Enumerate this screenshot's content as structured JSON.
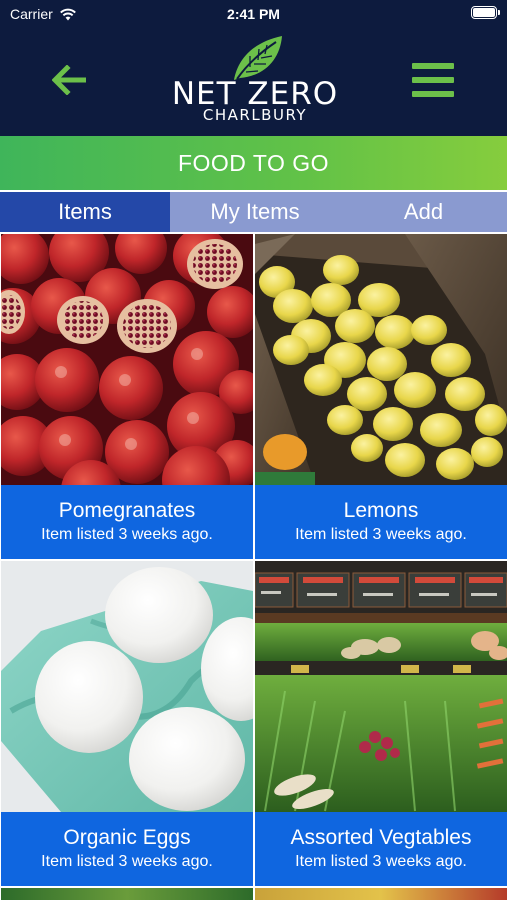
{
  "status_bar": {
    "carrier": "Carrier",
    "time": "2:41 PM"
  },
  "header": {
    "logo_line1": "NET ZERO",
    "logo_line2": "CHARLBURY",
    "back_icon": "arrow-left-icon",
    "menu_icon": "hamburger-menu-icon"
  },
  "section": {
    "title": "FOOD TO GO"
  },
  "tabs": [
    {
      "label": "Items",
      "selected": true
    },
    {
      "label": "My Items",
      "selected": false
    },
    {
      "label": "Add",
      "selected": false
    }
  ],
  "items": [
    {
      "name": "Pomegranates",
      "listed": "Item listed 3 weeks ago."
    },
    {
      "name": "Lemons",
      "listed": "Item listed 3 weeks ago."
    },
    {
      "name": "Organic Eggs",
      "listed": "Item listed 3 weeks ago."
    },
    {
      "name": "Assorted Vegtables",
      "listed": "Item listed 3 weeks ago."
    }
  ],
  "colors": {
    "header_bg": "#0d1b3e",
    "brand_green": "#6cc04a",
    "tab_selected": "#2448a8",
    "tab_unselected": "#8a9ad0",
    "card_caption": "#0f66e0"
  }
}
